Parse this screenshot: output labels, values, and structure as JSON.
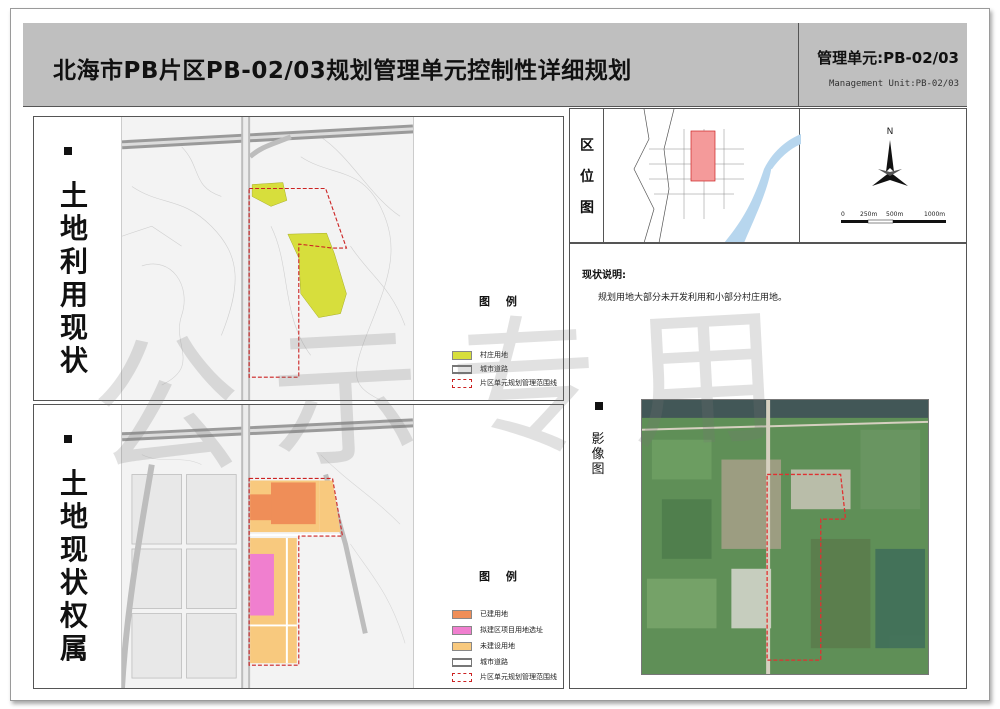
{
  "header": {
    "title": "北海市PB片区PB-02/03规划管理单元控制性详细规划",
    "unit_cn": "管理单元:PB-02/03",
    "unit_en": "Management Unit:PB-02/03"
  },
  "landuse_panel": {
    "label_chars": [
      "土",
      "地",
      "利",
      "用",
      "现",
      "状"
    ],
    "legend_title": "图  例",
    "legend": [
      {
        "label": "村庄用地",
        "color": "#d7de3c"
      },
      {
        "label": "城市道路",
        "color": "#ffffff"
      },
      {
        "label": "片区单元规划管理范围线",
        "color": "#cc2222"
      }
    ]
  },
  "ownership_panel": {
    "label_chars": [
      "土",
      "地",
      "现",
      "状",
      "权",
      "属"
    ],
    "legend_title": "图  例",
    "legend": [
      {
        "label": "已建用地",
        "color": "#ef8e58"
      },
      {
        "label": "拟建区项目用地选址",
        "color": "#f07fcf"
      },
      {
        "label": "未建设用地",
        "color": "#f8c97e"
      },
      {
        "label": "城市道路",
        "color": "#ffffff"
      },
      {
        "label": "片区单元规划管理范围线",
        "color": "#cc2222"
      }
    ]
  },
  "locator": {
    "label_chars": [
      "区",
      "位",
      "图"
    ],
    "north_letter": "N",
    "scale_labels": [
      "0",
      "250m",
      "500m",
      "1000m"
    ]
  },
  "description": {
    "title": "现状说明:",
    "text": "规划用地大部分未开发利用和小部分村庄用地。",
    "image_label": "影像图"
  },
  "watermark": "公示专用"
}
